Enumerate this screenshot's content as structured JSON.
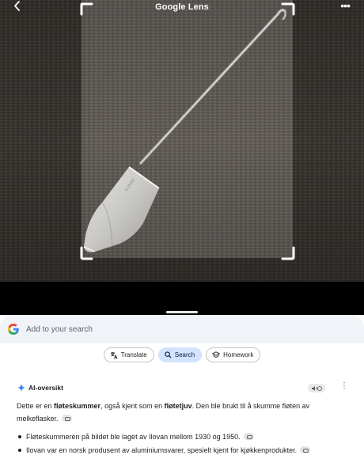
{
  "app": {
    "title": "Google Lens"
  },
  "search": {
    "placeholder": "Add to your search"
  },
  "chips": [
    {
      "label": "Translate",
      "icon": "translate-icon"
    },
    {
      "label": "Search",
      "icon": "search-icon"
    },
    {
      "label": "Homework",
      "icon": "school-icon"
    }
  ],
  "ai_overview": {
    "title": "AI-oversikt",
    "intro": {
      "p1": "Dette er en ",
      "b1": "fløteskummer",
      "p2": ", også kjent som en ",
      "b2": "fløtetjuv",
      "p3": ". Den ble brukt til å skumme fløten av melkeflasker."
    },
    "bullets": [
      "Fløteskummeren på bildet ble laget av Ilovan mellom 1930 og 1950.",
      "Ilovan var en norsk produsent av aluminiumsvarer, spesielt kjent for kjøkkenprodukter."
    ]
  },
  "colors": {
    "accent_chip": "#d3e3fd",
    "search_bg": "#f0f4f9",
    "surface": "#ffffff"
  }
}
